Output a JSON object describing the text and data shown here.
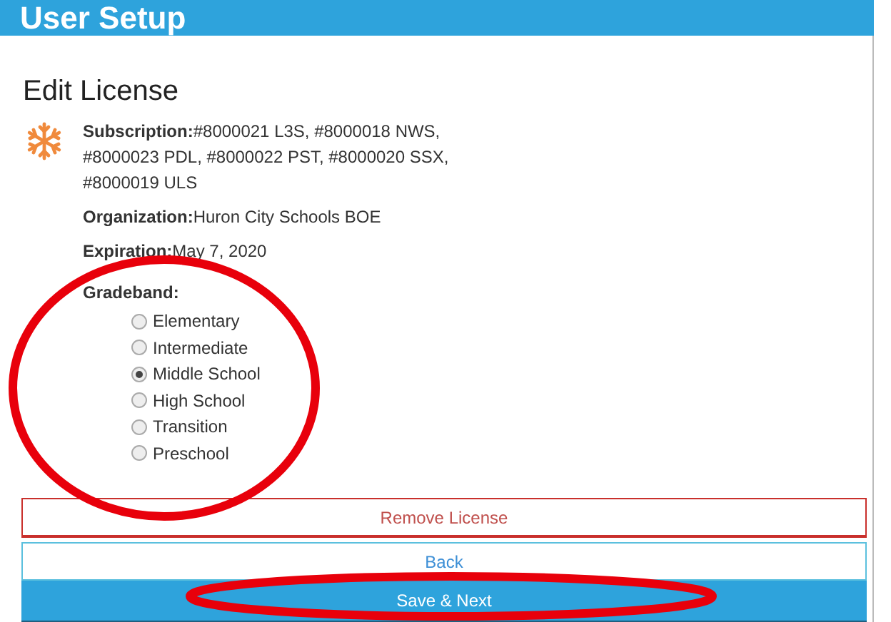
{
  "header": {
    "title": "User Setup"
  },
  "heading": "Edit License",
  "details": [
    {
      "label": "Subscription:",
      "value": "#8000021 L3S, #8000018 NWS, #8000023 PDL, #8000022 PST, #8000020 SSX, #8000019 ULS"
    },
    {
      "label": "Organization:",
      "value": "Huron City Schools BOE"
    },
    {
      "label": "Expiration:",
      "value": "May 7, 2020"
    }
  ],
  "gradeband": {
    "label": "Gradeband:",
    "circled": true,
    "options": [
      {
        "label": "Elementary",
        "selected": false
      },
      {
        "label": "Intermediate",
        "selected": false
      },
      {
        "label": "Middle School",
        "selected": true
      },
      {
        "label": "High School",
        "selected": false
      },
      {
        "label": "Transition",
        "selected": false
      },
      {
        "label": "Preschool",
        "selected": false
      }
    ]
  },
  "buttons": [
    {
      "kind": "danger",
      "label": "Remove License",
      "circled": false
    },
    {
      "kind": "outline",
      "label": "Back",
      "circled": false
    },
    {
      "kind": "primary",
      "label": "Save & Next",
      "circled": true
    }
  ]
}
